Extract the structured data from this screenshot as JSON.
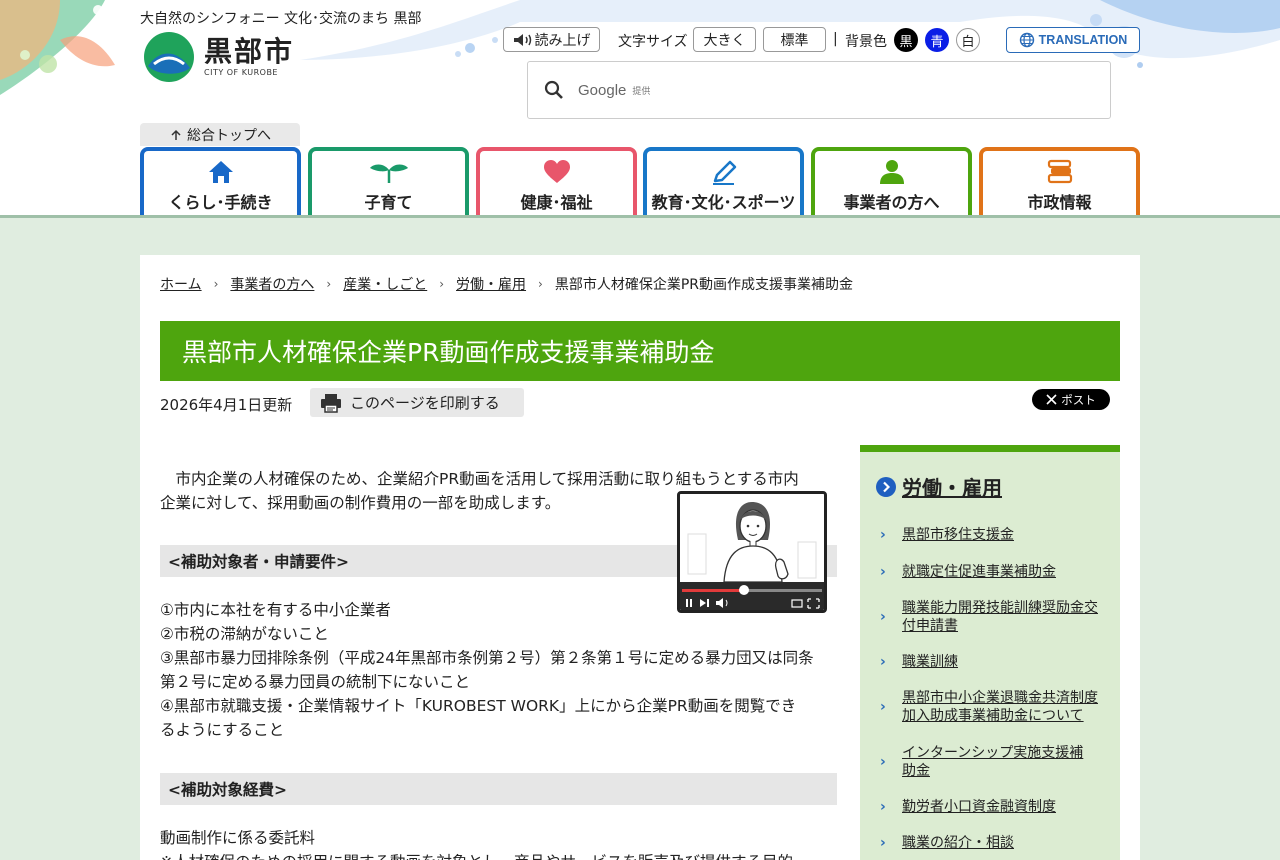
{
  "header": {
    "tagline": "大自然のシンフォニー 文化･交流のまち 黒部",
    "logo_name": "黒部市",
    "logo_sub": "CITY OF KUROBE",
    "read_aloud": "読み上げ",
    "font_size_label": "文字サイズ",
    "font_larger": "大きく",
    "font_normal": "標準",
    "divider": "|",
    "bg_label": "背景色",
    "bg_black": "黒",
    "bg_blue": "青",
    "bg_white": "白",
    "translation": "TRANSLATION",
    "search_brand": "Google",
    "search_provided": "提供",
    "top_link": "総合トップへ"
  },
  "nav": {
    "tabs": [
      {
        "label": "くらし･手続き",
        "color": "#1868c8"
      },
      {
        "label": "子育て",
        "color": "#1a9a6a"
      },
      {
        "label": "健康･福祉",
        "color": "#e8566b"
      },
      {
        "label": "教育･文化･スポーツ",
        "color": "#1877c8"
      },
      {
        "label": "事業者の方へ",
        "color": "#4ea50e"
      },
      {
        "label": "市政情報",
        "color": "#e07318"
      }
    ]
  },
  "breadcrumb": {
    "items": [
      "ホーム",
      "事業者の方へ",
      "産業・しごと",
      "労働・雇用"
    ],
    "current": "黒部市人材確保企業PR動画作成支援事業補助金"
  },
  "page": {
    "title": "黒部市人材確保企業PR動画作成支援事業補助金",
    "updated": "2026年4月1日更新",
    "print_label": "このページを印刷する",
    "post_label": "ポスト"
  },
  "content": {
    "intro_1": "　市内企業の人材確保のため、企業紹介PR動画を活用して採用活動に取り組もうとする市内",
    "intro_2": "企業に対して、採用動画の制作費用の一部を助成します。",
    "section1_title": "<補助対象者・申請要件>",
    "req_1": "①市内に本社を有する中小企業者",
    "req_2": "②市税の滞納がないこと",
    "req_3a": "③黒部市暴力団排除条例（平成24年黒部市条例第２号）第２条第１号に定める暴力団又は同条",
    "req_3b": "第２号に定める暴力団員の統制下にないこと",
    "req_4a": "④黒部市就職支援・企業情報サイト「KUROBEST WORK」上にから企業PR動画を閲覧でき",
    "req_4b": "るようにすること",
    "section2_title": "<補助対象経費>",
    "expense_1": "動画制作に係る委託料",
    "expense_2": "※人材確保のための採用に関する動画を対象とし、商品やサービスを販売及び提供する目的"
  },
  "sidebar": {
    "title": "労働・雇用",
    "items": [
      {
        "label1": "黒部市移住支援金",
        "label2": ""
      },
      {
        "label1": "就職定住促進事業補助金",
        "label2": ""
      },
      {
        "label1": "職業能力開発技能訓練奨励金交",
        "label2": "付申請書"
      },
      {
        "label1": "職業訓練",
        "label2": ""
      },
      {
        "label1": "黒部市中小企業退職金共済制度",
        "label2": "加入助成事業補助金について"
      },
      {
        "label1": "インターンシップ実施支援補",
        "label2": "助金"
      },
      {
        "label1": "勤労者小口資金融資制度",
        "label2": ""
      },
      {
        "label1": "職業の紹介・相談",
        "label2": ""
      }
    ]
  },
  "colors": {
    "accent_green": "#4ea50e",
    "link_blue": "#2a6bb8",
    "page_bg": "#e0ede0"
  }
}
